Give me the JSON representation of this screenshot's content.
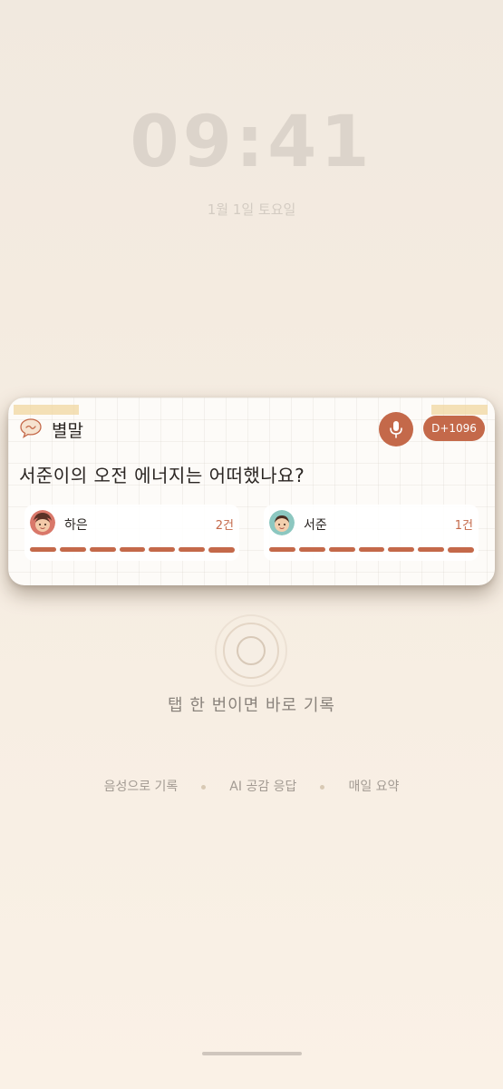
{
  "lockscreen": {
    "time": "09:41",
    "date": "1월 1일 토요일"
  },
  "widget": {
    "app_name": "별말",
    "logo_icon": "speech-bubble-logo-icon",
    "mic_icon": "microphone-icon",
    "dday_label": "D+1096",
    "question": "서준이의 오전 에너지는 어떠했나요?",
    "accent_color": "#c4694a",
    "children": [
      {
        "name": "하은",
        "count": "2건",
        "avatar_icon": "child-avatar-icon"
      },
      {
        "name": "서준",
        "count": "1건",
        "avatar_icon": "child-avatar-icon"
      }
    ]
  },
  "hint": {
    "tap_text": "탭 한 번이면 바로 기록"
  },
  "features": [
    "음성으로 기록",
    "AI 공감 응답",
    "매일 요약"
  ]
}
